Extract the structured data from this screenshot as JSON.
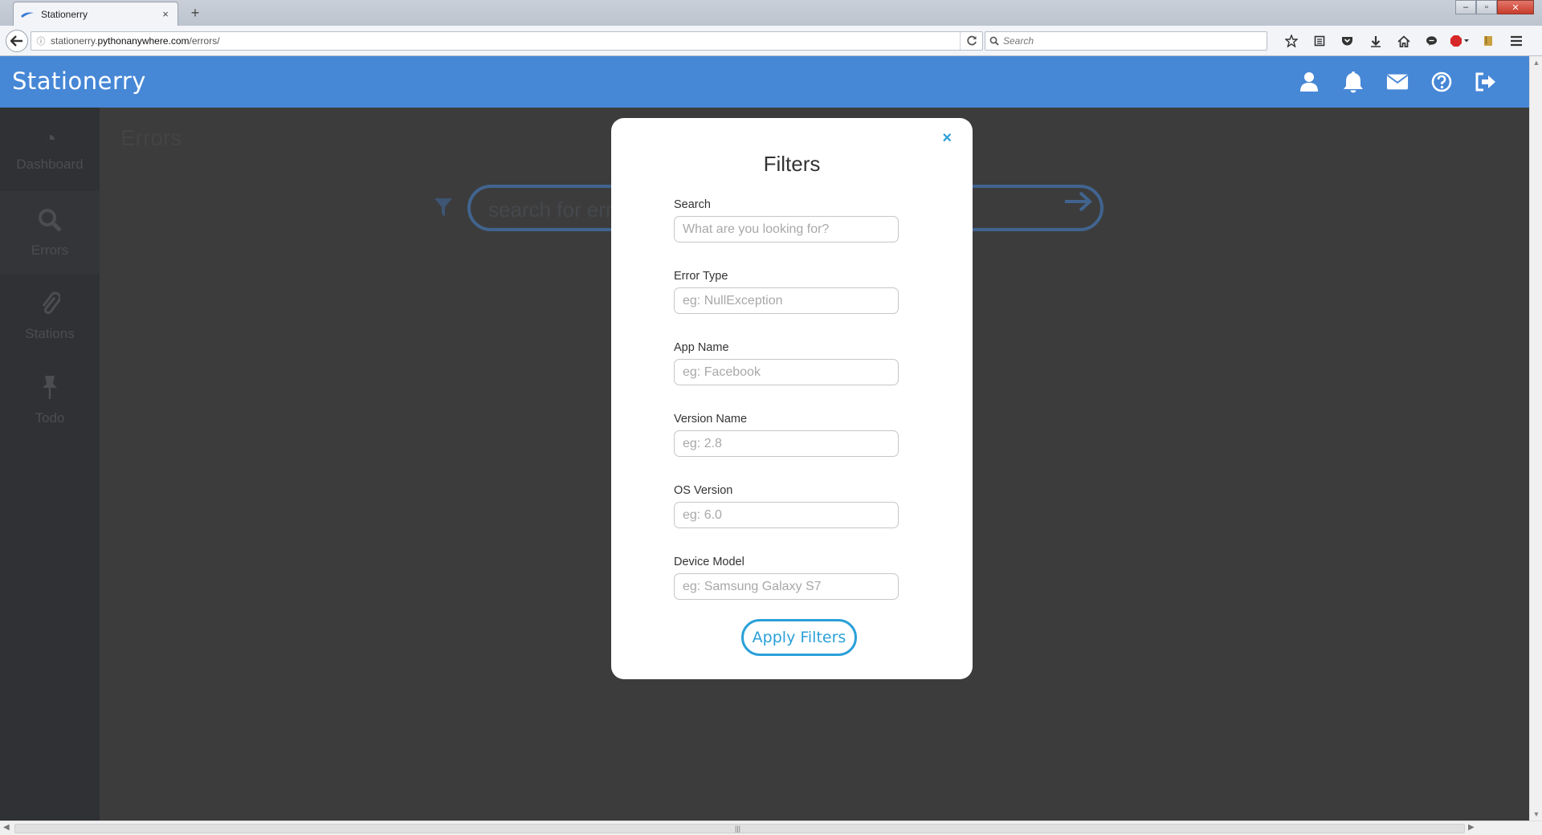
{
  "browser": {
    "tab_title": "Stationerry",
    "tab_close": "×",
    "new_tab": "+",
    "url_plain_prefix": "stationerry.",
    "url_host": "pythonanywhere.com",
    "url_path": "/errors/",
    "search_placeholder": "Search",
    "window_controls": [
      "–",
      "▫",
      "✕"
    ]
  },
  "app": {
    "brand": "Stationerry",
    "header_icons": [
      "user-icon",
      "bell-icon",
      "envelope-icon",
      "help-icon",
      "logout-icon"
    ],
    "sidebar": {
      "items": [
        {
          "label": "Dashboard",
          "icon": "gauge-icon",
          "active": false
        },
        {
          "label": "Errors",
          "icon": "search-icon",
          "active": true
        },
        {
          "label": "Stations",
          "icon": "paperclip-icon",
          "active": false
        },
        {
          "label": "Todo",
          "icon": "pin-icon",
          "active": false
        }
      ]
    },
    "page_title": "Errors",
    "background_search_text": "search for errors"
  },
  "modal": {
    "close_label": "×",
    "title": "Filters",
    "fields": [
      {
        "label": "Search",
        "placeholder": "What are you looking for?",
        "value": ""
      },
      {
        "label": "Error Type",
        "placeholder": "eg: NullException",
        "value": ""
      },
      {
        "label": "App Name",
        "placeholder": "eg: Facebook",
        "value": ""
      },
      {
        "label": "Version Name",
        "placeholder": "eg: 2.8",
        "value": ""
      },
      {
        "label": "OS Version",
        "placeholder": "eg: 6.0",
        "value": ""
      },
      {
        "label": "Device Model",
        "placeholder": "eg: Samsung Galaxy S7",
        "value": ""
      }
    ],
    "apply_label": "Apply Filters"
  },
  "colors": {
    "header_blue": "#4687d6",
    "accent": "#2aa0d8",
    "overlay": "#3c3c3c"
  }
}
